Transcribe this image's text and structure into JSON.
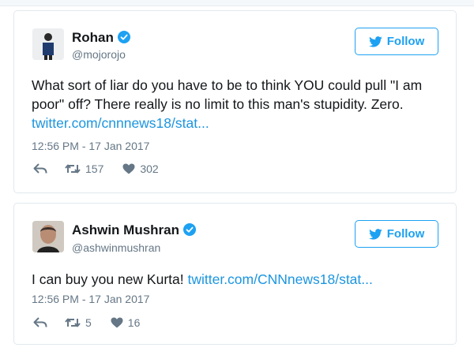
{
  "tweets": [
    {
      "display_name": "Rohan",
      "handle": "@mojorojo",
      "follow_label": "Follow",
      "text": "What sort of liar do you have to be to think YOU could pull \"I am poor\" off? There really is no limit to this man's stupidity. Zero. ",
      "link_text": "twitter.com/cnnnews18/stat...",
      "timestamp": "12:56 PM - 17 Jan 2017",
      "retweets": "157",
      "likes": "302"
    },
    {
      "display_name": "Ashwin Mushran",
      "handle": "@ashwinmushran",
      "follow_label": "Follow",
      "text": "I can buy you new Kurta! ",
      "link_text": "twitter.com/CNNnews18/stat...",
      "timestamp": "12:56 PM - 17 Jan 2017",
      "retweets": "5",
      "likes": "16"
    }
  ],
  "icons": {
    "verified": "verified-badge-icon",
    "follow": "twitter-bird-icon",
    "reply": "reply-arrow-icon",
    "retweet": "retweet-icon",
    "like": "heart-icon"
  },
  "colors": {
    "brand_blue": "#1da1f2",
    "link_blue": "#1b95e0",
    "muted_text": "#657786",
    "card_border": "#e1e8ed"
  }
}
